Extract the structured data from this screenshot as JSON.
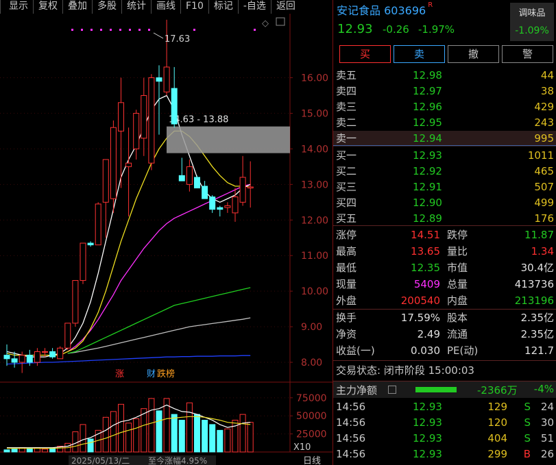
{
  "toolbar": {
    "items": [
      "显示",
      "复权",
      "叠加",
      "多股",
      "统计",
      "画线",
      "F10",
      "标记",
      "-自选",
      "返回"
    ]
  },
  "stock": {
    "name": "安记食品",
    "code": "603696",
    "flag": "R",
    "price": "12.93",
    "change": "-0.26",
    "change_pct": "-1.97%"
  },
  "sector": {
    "label": "调味品",
    "pct": "-1.09%"
  },
  "trade_buttons": {
    "buy": "买",
    "sell": "卖",
    "cancel": "撤",
    "alert": "警"
  },
  "orderbook": {
    "sells": [
      {
        "label": "卖五",
        "price": "12.98",
        "vol": "44"
      },
      {
        "label": "卖四",
        "price": "12.97",
        "vol": "38"
      },
      {
        "label": "卖三",
        "price": "12.96",
        "vol": "429"
      },
      {
        "label": "卖二",
        "price": "12.95",
        "vol": "243"
      },
      {
        "label": "卖一",
        "price": "12.94",
        "vol": "995"
      }
    ],
    "buys": [
      {
        "label": "买一",
        "price": "12.93",
        "vol": "1011"
      },
      {
        "label": "买二",
        "price": "12.92",
        "vol": "465"
      },
      {
        "label": "买三",
        "price": "12.91",
        "vol": "507"
      },
      {
        "label": "买四",
        "price": "12.90",
        "vol": "499"
      },
      {
        "label": "买五",
        "price": "12.89",
        "vol": "176"
      }
    ]
  },
  "stats1": [
    {
      "k1": "涨停",
      "v1": "14.51",
      "c1": "red",
      "k2": "跌停",
      "v2": "11.87",
      "c2": "green"
    },
    {
      "k1": "最高",
      "v1": "13.65",
      "c1": "red",
      "k2": "量比",
      "v2": "1.34",
      "c2": "red"
    },
    {
      "k1": "最低",
      "v1": "12.35",
      "c1": "green",
      "k2": "市值",
      "v2": "30.4亿",
      "c2": "white"
    },
    {
      "k1": "现量",
      "v1": "5409",
      "c1": "magenta",
      "k2": "总量",
      "v2": "413736",
      "c2": "white"
    },
    {
      "k1": "外盘",
      "v1": "200540",
      "c1": "red",
      "k2": "内盘",
      "v2": "213196",
      "c2": "green"
    }
  ],
  "stats2": [
    {
      "k1": "换手",
      "v1": "17.59%",
      "k2": "股本",
      "v2": "2.35亿"
    },
    {
      "k1": "净资",
      "v1": "2.49",
      "k2": "流通",
      "v2": "2.35亿"
    },
    {
      "k1": "收益(一)",
      "v1": "0.030",
      "k2": "PE(动)",
      "v2": "121.7"
    }
  ],
  "trade_status": "交易状态: 闭市阶段 15:00:03",
  "main_flow": {
    "label": "主力净额",
    "value": "-2366万",
    "pct": "-4%"
  },
  "ticks": [
    {
      "time": "14:56",
      "price": "12.93",
      "vol": "129",
      "side": "S",
      "side_color": "green",
      "num": "24"
    },
    {
      "time": "14:56",
      "price": "12.93",
      "vol": "120",
      "side": "S",
      "side_color": "green",
      "num": "30"
    },
    {
      "time": "14:56",
      "price": "12.93",
      "vol": "404",
      "side": "S",
      "side_color": "green",
      "num": "51"
    },
    {
      "time": "14:56",
      "price": "12.93",
      "vol": "299",
      "side": "B",
      "side_color": "red",
      "num": "26"
    }
  ],
  "chart_labels": {
    "high_label": "17.63",
    "range_label": "14.63 - 13.88",
    "price_ticks": [
      "16.00",
      "15.00",
      "14.00",
      "13.00",
      "12.00",
      "11.00",
      "10.00",
      "9.00",
      "8.00"
    ],
    "vol_ticks": [
      "75000",
      "50000",
      "25000"
    ],
    "vol_unit": "X10",
    "marker_zhang": "涨",
    "marker_cai": "财",
    "marker_ranks": "跌榜",
    "date_label": "2025/05/13/二",
    "range_pct": "至今涨幅4.95%",
    "period": "日线"
  },
  "chart_data": {
    "type": "candlestick",
    "price_ylim": [
      7.5,
      17.8
    ],
    "candles": [
      {
        "o": 8.2,
        "h": 8.5,
        "l": 7.9,
        "c": 8.1
      },
      {
        "o": 8.1,
        "h": 8.3,
        "l": 7.85,
        "c": 8.0
      },
      {
        "o": 8.0,
        "h": 8.3,
        "l": 7.7,
        "c": 8.2
      },
      {
        "o": 8.2,
        "h": 8.35,
        "l": 7.9,
        "c": 8.0
      },
      {
        "o": 8.0,
        "h": 8.4,
        "l": 7.9,
        "c": 8.3
      },
      {
        "o": 8.3,
        "h": 8.4,
        "l": 8.15,
        "c": 8.3
      },
      {
        "o": 8.3,
        "h": 8.4,
        "l": 8.1,
        "c": 8.15
      },
      {
        "o": 8.1,
        "h": 8.45,
        "l": 8.1,
        "c": 8.4
      },
      {
        "o": 8.4,
        "h": 9.1,
        "l": 8.35,
        "c": 9.1
      },
      {
        "o": 9.1,
        "h": 10.3,
        "l": 9.0,
        "c": 10.3
      },
      {
        "o": 10.3,
        "h": 11.35,
        "l": 10.2,
        "c": 11.35
      },
      {
        "o": 11.35,
        "h": 11.4,
        "l": 11.25,
        "c": 11.3
      },
      {
        "o": 11.3,
        "h": 12.5,
        "l": 11.3,
        "c": 12.45
      },
      {
        "o": 12.5,
        "h": 13.6,
        "l": 11.5,
        "c": 13.7
      },
      {
        "o": 12.6,
        "h": 14.8,
        "l": 12.2,
        "c": 14.6
      },
      {
        "o": 14.5,
        "h": 16.0,
        "l": 12.9,
        "c": 15.3
      },
      {
        "o": 13.5,
        "h": 14.6,
        "l": 12.1,
        "c": 13.6
      },
      {
        "o": 14.0,
        "h": 15.1,
        "l": 13.7,
        "c": 15.0
      },
      {
        "o": 14.3,
        "h": 16.0,
        "l": 13.8,
        "c": 15.5
      },
      {
        "o": 13.6,
        "h": 16.1,
        "l": 13.4,
        "c": 16.0
      },
      {
        "o": 16.0,
        "h": 16.35,
        "l": 14.4,
        "c": 15.9
      },
      {
        "o": 15.6,
        "h": 17.63,
        "l": 15.5,
        "c": 16.3
      },
      {
        "o": 15.7,
        "h": 16.3,
        "l": 14.6,
        "c": 14.7
      },
      {
        "o": 13.25,
        "h": 13.75,
        "l": 13.2,
        "c": 13.1
      },
      {
        "o": 13.0,
        "h": 13.7,
        "l": 12.8,
        "c": 13.5
      },
      {
        "o": 13.2,
        "h": 13.25,
        "l": 12.9,
        "c": 12.9
      },
      {
        "o": 12.95,
        "h": 13.1,
        "l": 12.6,
        "c": 12.6
      },
      {
        "o": 12.65,
        "h": 12.7,
        "l": 12.2,
        "c": 12.3
      },
      {
        "o": 12.35,
        "h": 12.4,
        "l": 12.1,
        "c": 12.3
      },
      {
        "o": 12.35,
        "h": 12.5,
        "l": 12.2,
        "c": 12.4
      },
      {
        "o": 12.2,
        "h": 12.9,
        "l": 11.95,
        "c": 12.65
      },
      {
        "o": 12.5,
        "h": 13.8,
        "l": 12.4,
        "c": 13.2
      },
      {
        "o": 12.9,
        "h": 13.65,
        "l": 12.35,
        "c": 12.93
      }
    ],
    "ma_white": [
      8.3,
      8.25,
      8.2,
      8.15,
      8.15,
      8.15,
      8.2,
      8.25,
      8.4,
      8.7,
      9.1,
      9.7,
      10.5,
      11.4,
      12.3,
      13.2,
      13.7,
      14.1,
      14.6,
      15.1,
      15.4,
      15.5,
      15.1,
      14.4,
      13.8,
      13.2,
      12.8,
      12.6,
      12.5,
      12.6,
      12.7,
      12.9,
      13.0
    ],
    "ma_yellow": [
      8.25,
      8.2,
      8.2,
      8.2,
      8.2,
      8.2,
      8.2,
      8.2,
      8.3,
      8.4,
      8.6,
      8.95,
      9.4,
      10.0,
      10.7,
      11.4,
      12.0,
      12.6,
      13.1,
      13.6,
      14.0,
      14.3,
      14.5,
      14.5,
      14.35,
      14.1,
      13.8,
      13.5,
      13.25,
      13.05,
      12.95,
      12.95,
      12.93
    ],
    "ma_magenta": [
      null,
      null,
      null,
      null,
      null,
      null,
      null,
      null,
      8.3,
      8.45,
      8.65,
      8.9,
      9.2,
      9.55,
      9.9,
      10.3,
      10.6,
      10.9,
      11.2,
      11.45,
      11.7,
      11.9,
      12.05,
      12.15,
      12.25,
      12.35,
      12.45,
      12.55,
      12.65,
      12.75,
      12.85,
      12.95,
      13.0
    ],
    "ma_green": [
      null,
      null,
      null,
      null,
      null,
      null,
      null,
      null,
      8.25,
      8.3,
      8.4,
      8.5,
      8.6,
      8.7,
      8.8,
      8.9,
      9.0,
      9.1,
      9.2,
      9.3,
      9.4,
      9.5,
      9.6,
      9.65,
      9.7,
      9.75,
      9.8,
      9.85,
      9.9,
      9.95,
      10.0,
      10.05,
      10.1
    ],
    "ma_gray": [
      null,
      null,
      null,
      null,
      null,
      null,
      null,
      null,
      8.25,
      8.28,
      8.32,
      8.36,
      8.4,
      8.45,
      8.5,
      8.55,
      8.6,
      8.65,
      8.7,
      8.75,
      8.8,
      8.85,
      8.9,
      8.95,
      9.0,
      9.03,
      9.06,
      9.09,
      9.12,
      9.15,
      9.18,
      9.21,
      9.25
    ],
    "ma_blue": [
      7.95,
      7.96,
      7.97,
      7.98,
      7.99,
      8.0,
      8.0,
      8.01,
      8.02,
      8.03,
      8.04,
      8.05,
      8.06,
      8.07,
      8.08,
      8.09,
      8.1,
      8.11,
      8.12,
      8.13,
      8.14,
      8.15,
      8.15,
      8.16,
      8.16,
      8.17,
      8.17,
      8.17,
      8.18,
      8.18,
      8.18,
      8.19,
      8.19
    ],
    "volume_ylim": [
      0,
      90000
    ],
    "volumes": [
      3000,
      4000,
      6000,
      5000,
      6000,
      4000,
      5000,
      8000,
      12000,
      28000,
      38000,
      18000,
      30000,
      48000,
      56000,
      66000,
      40000,
      46000,
      60000,
      74000,
      57000,
      74000,
      52000,
      44000,
      68000,
      52000,
      44000,
      38000,
      30000,
      32000,
      44000,
      52000,
      41000
    ],
    "vol_ma1": [
      6000,
      6000,
      6000,
      6000,
      6000,
      6000,
      6000,
      7000,
      8000,
      12000,
      17000,
      20000,
      25000,
      30000,
      37000,
      42000,
      44000,
      48000,
      53000,
      58000,
      60000,
      65000,
      60000,
      56000,
      55000,
      52000,
      48000,
      44000,
      38000,
      34000,
      36000,
      40000,
      41000
    ],
    "vol_ma2": [
      5000,
      5000,
      5000,
      5000,
      5000,
      5000,
      5000,
      5500,
      6000,
      8000,
      11000,
      13000,
      16000,
      19000,
      23000,
      27000,
      30000,
      33000,
      37000,
      40000,
      43000,
      46000,
      47000,
      48000,
      49000,
      49000,
      48000,
      46000,
      44000,
      41000,
      40000,
      39000,
      38000
    ]
  }
}
